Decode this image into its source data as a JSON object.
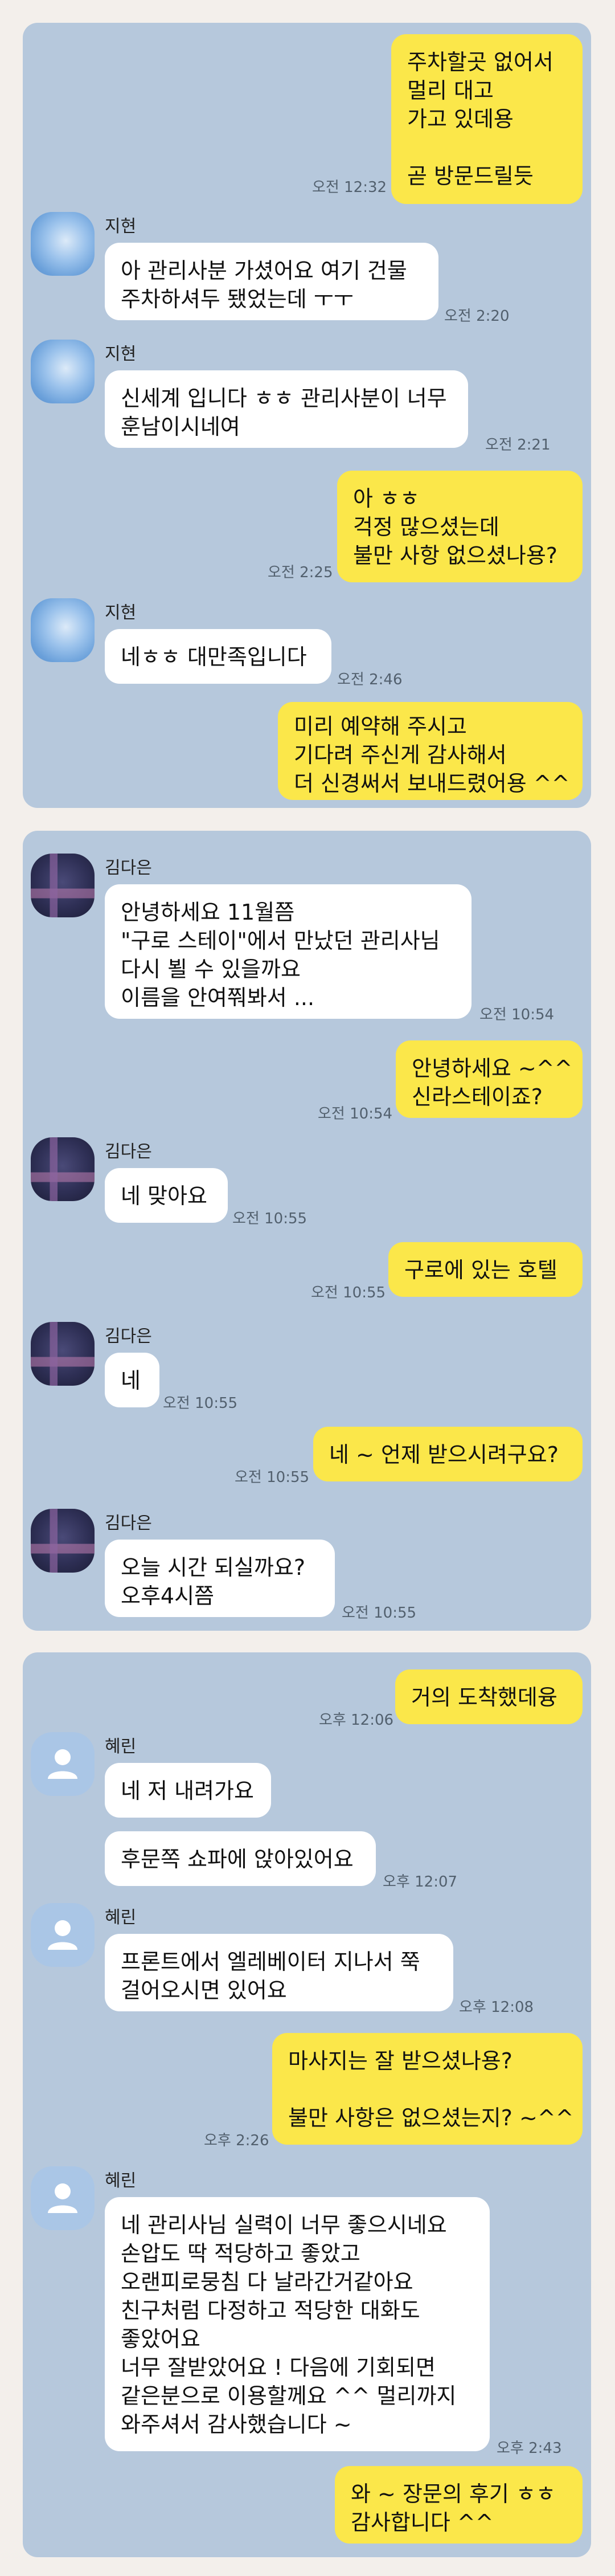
{
  "panel1": {
    "messages": [
      {
        "from": "me",
        "lines": [
          "주차할곳 없어서",
          "멀리 대고",
          "가고 있데용",
          "",
          "곧 방문드릴듯"
        ],
        "time": "오전 12:32"
      },
      {
        "from": "them",
        "sender": "지현",
        "lines": [
          "아 관리사분 가셨어요 여기 건물",
          "주차하셔두 됐었는데 ㅜㅜ"
        ],
        "time": "오전 2:20"
      },
      {
        "from": "them",
        "sender": "지현",
        "lines": [
          "신세계 입니다 ㅎㅎ 관리사분이 너무",
          "훈남이시네여"
        ],
        "time": "오전 2:21"
      },
      {
        "from": "me",
        "lines": [
          "아 ㅎㅎ",
          "걱정 많으셨는데",
          "불만 사항 없으셨나용?"
        ],
        "time": "오전 2:25"
      },
      {
        "from": "them",
        "sender": "지현",
        "lines": [
          "네ㅎㅎ 대만족입니다"
        ],
        "time": "오전 2:46"
      },
      {
        "from": "me",
        "lines": [
          "미리 예약해 주시고",
          "기다려 주신게 감사해서",
          "더 신경써서 보내드렸어용 ^^"
        ]
      }
    ]
  },
  "panel2": {
    "messages": [
      {
        "from": "them",
        "sender": "김다은",
        "lines": [
          "안녕하세요 11월쯤",
          "\"구로 스테이\"에서 만났던 관리사님",
          "다시 뵐 수 있을까요",
          "이름을 안여쭤봐서 ..."
        ],
        "time": "오전 10:54"
      },
      {
        "from": "me",
        "lines": [
          "안녕하세요 ~^^",
          "신라스테이죠?"
        ],
        "time": "오전 10:54"
      },
      {
        "from": "them",
        "sender": "김다은",
        "lines": [
          "네 맞아요"
        ],
        "time": "오전 10:55"
      },
      {
        "from": "me",
        "lines": [
          "구로에 있는 호텔"
        ],
        "time": "오전 10:55"
      },
      {
        "from": "them",
        "sender": "김다은",
        "lines": [
          "네"
        ],
        "time": "오전 10:55"
      },
      {
        "from": "me",
        "lines": [
          "네 ~ 언제 받으시려구요?"
        ],
        "time": "오전 10:55"
      },
      {
        "from": "them",
        "sender": "김다은",
        "lines": [
          "오늘  시간 되실까요?",
          "오후4시쯤"
        ],
        "time": "오전 10:55"
      }
    ]
  },
  "panel3": {
    "messages": [
      {
        "from": "me",
        "lines": [
          "거의 도착했데융"
        ],
        "time": "오후 12:06"
      },
      {
        "from": "them",
        "sender": "혜린",
        "lines": [
          "네 저 내려가요"
        ]
      },
      {
        "from": "them",
        "lines": [
          "후문쪽 쇼파에 앉아있어요"
        ],
        "time": "오후 12:07"
      },
      {
        "from": "them",
        "sender": "혜린",
        "lines": [
          "프론트에서 엘레베이터 지나서 쭉",
          "걸어오시면 있어요"
        ],
        "time": "오후 12:08"
      },
      {
        "from": "me",
        "lines": [
          "마사지는 잘 받으셨나용?",
          "",
          "불만 사항은 없으셨는지? ~^^"
        ],
        "time": "오후 2:26"
      },
      {
        "from": "them",
        "sender": "혜린",
        "lines": [
          "네 관리사님 실력이 너무 좋으시네요",
          "손압도 딱 적당하고 좋았고",
          "오랜피로뭉침 다 날라간거같아요",
          "친구처럼 다정하고 적당한 대화도",
          "좋았어요",
          "너무 잘받았어요 ! 다음에 기회되면",
          "같은분으로 이용할께요 ^^ 멀리까지",
          "와주셔서 감사했습니다 ~"
        ],
        "time": "오후 2:43"
      },
      {
        "from": "me",
        "lines": [
          "와 ~ 장문의 후기 ㅎㅎ",
          "감사합니다 ^^"
        ]
      }
    ]
  }
}
